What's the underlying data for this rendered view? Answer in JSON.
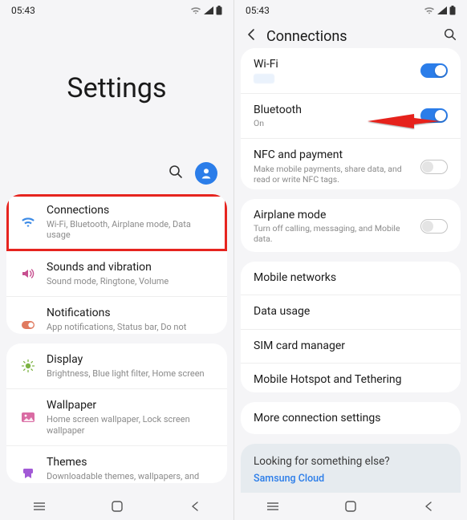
{
  "status": {
    "time": "05:43"
  },
  "left": {
    "title": "Settings",
    "groups": [
      [
        {
          "key": "connections",
          "title": "Connections",
          "sub": "Wi-Fi, Bluetooth, Airplane mode, Data usage",
          "icon": "wifi",
          "color": "#3b8ae6",
          "hl": true
        },
        {
          "key": "sounds",
          "title": "Sounds and vibration",
          "sub": "Sound mode, Ringtone, Volume",
          "icon": "sound",
          "color": "#c75090"
        },
        {
          "key": "notifications",
          "title": "Notifications",
          "sub": "App notifications, Status bar, Do not disturb",
          "icon": "notif",
          "color": "#e07a5f"
        }
      ],
      [
        {
          "key": "display",
          "title": "Display",
          "sub": "Brightness, Blue light filter, Home screen",
          "icon": "display",
          "color": "#7cb342"
        },
        {
          "key": "wallpaper",
          "title": "Wallpaper",
          "sub": "Home screen wallpaper, Lock screen wallpaper",
          "icon": "wallpaper",
          "color": "#d96ba3"
        },
        {
          "key": "themes",
          "title": "Themes",
          "sub": "Downloadable themes, wallpapers, and icons",
          "icon": "themes",
          "color": "#a259d6"
        }
      ]
    ]
  },
  "right": {
    "header": "Connections",
    "groups": [
      [
        {
          "key": "wifi",
          "title": "Wi-Fi",
          "sub": "",
          "subClass": "smudge",
          "toggle": "on"
        },
        {
          "key": "bluetooth",
          "title": "Bluetooth",
          "sub": "On",
          "subClass": "on",
          "toggle": "on"
        },
        {
          "key": "nfc",
          "title": "NFC and payment",
          "sub": "Make mobile payments, share data, and read or write NFC tags.",
          "toggle": "off"
        }
      ],
      [
        {
          "key": "airplane",
          "title": "Airplane mode",
          "sub": "Turn off calling, messaging, and Mobile data.",
          "toggle": "off"
        }
      ],
      [
        {
          "key": "mobilenet",
          "title": "Mobile networks"
        },
        {
          "key": "datausage",
          "title": "Data usage"
        },
        {
          "key": "simcard",
          "title": "SIM card manager"
        },
        {
          "key": "hotspot",
          "title": "Mobile Hotspot and Tethering"
        }
      ],
      [
        {
          "key": "more",
          "title": "More connection settings"
        }
      ]
    ],
    "else": {
      "title": "Looking for something else?",
      "link": "Samsung Cloud"
    }
  }
}
